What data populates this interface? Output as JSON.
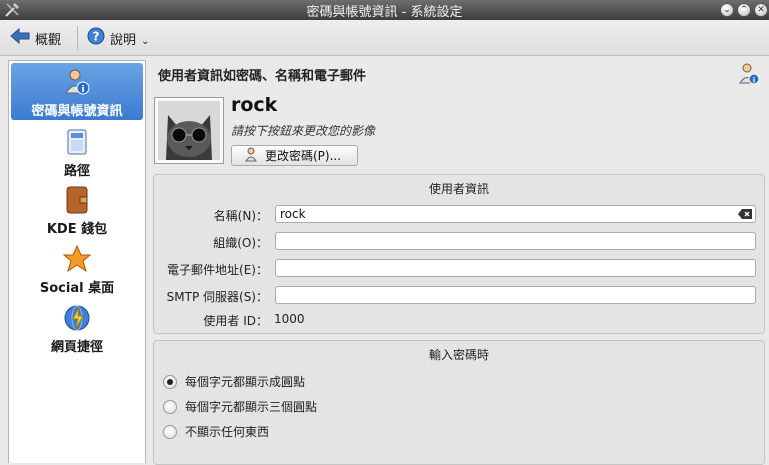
{
  "window": {
    "title": "密碼與帳號資訊 - 系統設定"
  },
  "toolbar": {
    "overview_label": "概觀",
    "help_label": "說明"
  },
  "sidebar": {
    "items": [
      {
        "label": "密碼與帳號資訊",
        "icon": "user-info-icon",
        "selected": true
      },
      {
        "label": "路徑",
        "icon": "folder-paths-icon"
      },
      {
        "label": "KDE 錢包",
        "icon": "wallet-icon"
      },
      {
        "label": "Social 桌面",
        "icon": "star-icon"
      },
      {
        "label": "網頁捷徑",
        "icon": "globe-lightning-icon"
      }
    ]
  },
  "main": {
    "heading": "使用者資訊如密碼、名稱和電子郵件",
    "username": "rock",
    "image_hint": "請按下按鈕來更改您的影像",
    "change_password_label": "更改密碼(P)...",
    "user_info": {
      "title": "使用者資訊",
      "name_label": "名稱(N)：",
      "name_value": "rock",
      "org_label": "組織(O)：",
      "org_value": "",
      "email_label": "電子郵件地址(E)：",
      "email_value": "",
      "smtp_label": "SMTP 伺服器(S)：",
      "smtp_value": "",
      "uid_label": "使用者 ID：",
      "uid_value": "1000"
    },
    "password_entry": {
      "title": "輸入密碼時",
      "options": [
        {
          "label": "每個字元都顯示成圓點",
          "selected": true
        },
        {
          "label": "每個字元都顯示三個圓點",
          "selected": false
        },
        {
          "label": "不顯示任何東西",
          "selected": false
        }
      ]
    }
  },
  "colors": {
    "selection": "#3b7bd0",
    "titlebar": "#4a4a4a"
  }
}
